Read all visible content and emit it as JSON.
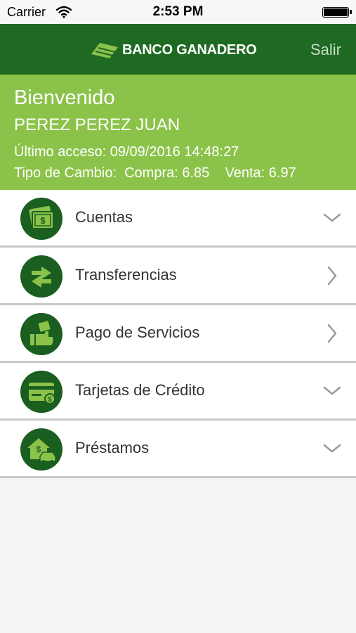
{
  "status_bar": {
    "carrier": "Carrier",
    "time": "2:53 PM",
    "battery_level": 1.0
  },
  "header": {
    "brand": "BANCO GANADERO",
    "exit_label": "Salir"
  },
  "welcome": {
    "greeting": "Bienvenido",
    "user_name": "PEREZ PEREZ JUAN",
    "last_access": "Último acceso: 09/09/2016 14:48:27",
    "exchange_rate": "Tipo de Cambio:  Compra: 6.85    Venta: 6.97"
  },
  "menu": [
    {
      "label": "Cuentas",
      "icon": "money-icon",
      "chevron": "down"
    },
    {
      "label": "Transferencias",
      "icon": "transfer-arrows-icon",
      "chevron": "right"
    },
    {
      "label": "Pago de Servicios",
      "icon": "payment-hand-icon",
      "chevron": "right"
    },
    {
      "label": "Tarjetas de Crédito",
      "icon": "credit-card-icon",
      "chevron": "down"
    },
    {
      "label": "Préstamos",
      "icon": "loan-house-car-icon",
      "chevron": "down"
    }
  ],
  "colors": {
    "header_green": "#1e6a23",
    "welcome_green": "#8bc34a",
    "icon_circle": "#1a5e20",
    "icon_accent": "#8bc34a"
  }
}
